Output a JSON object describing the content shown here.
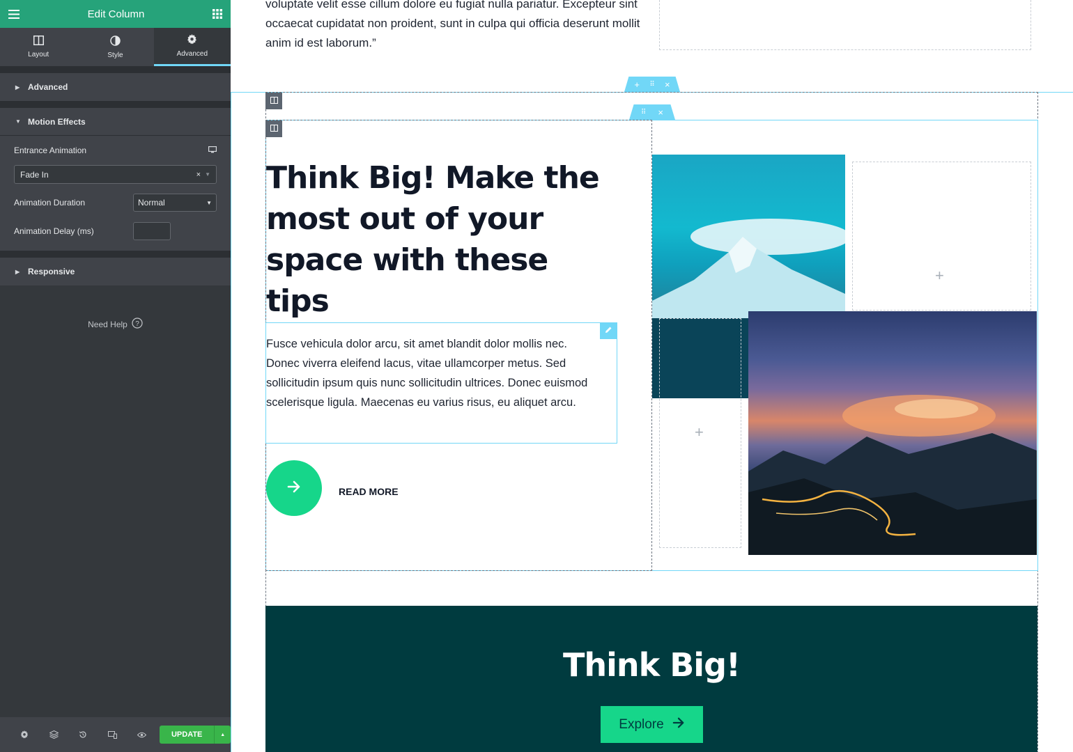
{
  "editor": {
    "title": "Edit Column",
    "tabs": [
      {
        "label": "Layout",
        "icon": "columns-icon"
      },
      {
        "label": "Style",
        "icon": "half-circle-icon"
      },
      {
        "label": "Advanced",
        "icon": "gear-icon"
      }
    ],
    "active_tab": "Advanced",
    "sections": {
      "advanced": "Advanced",
      "motion_effects": "Motion Effects",
      "responsive": "Responsive"
    },
    "controls": {
      "entrance_animation_label": "Entrance Animation",
      "entrance_animation_value": "Fade In",
      "duration_label": "Animation Duration",
      "duration_value": "Normal",
      "delay_label": "Animation Delay (ms)",
      "delay_value": ""
    },
    "need_help": "Need Help",
    "update_label": "UPDATE",
    "accent": "#26a37a"
  },
  "canvas": {
    "quote_text": "voluptate velit esse cillum dolore eu fugiat nulla pariatur. Excepteur sint occaecat cupidatat non proident, sunt in culpa qui officia deserunt mollit anim id est laborum.”",
    "heading": "Think Big! Make the most out of your space with these tips",
    "body_text": "Fusce vehicula dolor arcu, sit amet blandit dolor mollis nec. Donec viverra eleifend lacus, vitae ullamcorper metus. Sed sollicitudin ipsum quis nunc sollicitudin ultrices. Donec euismod scelerisque ligula. Maecenas eu varius risus, eu aliquet arcu.",
    "read_more": "READ MORE",
    "band_title": "Think Big!",
    "explore_label": "Explore",
    "colors": {
      "selection": "#71d7f7",
      "button_green": "#16d68a",
      "band_bg": "#003b3f"
    }
  }
}
